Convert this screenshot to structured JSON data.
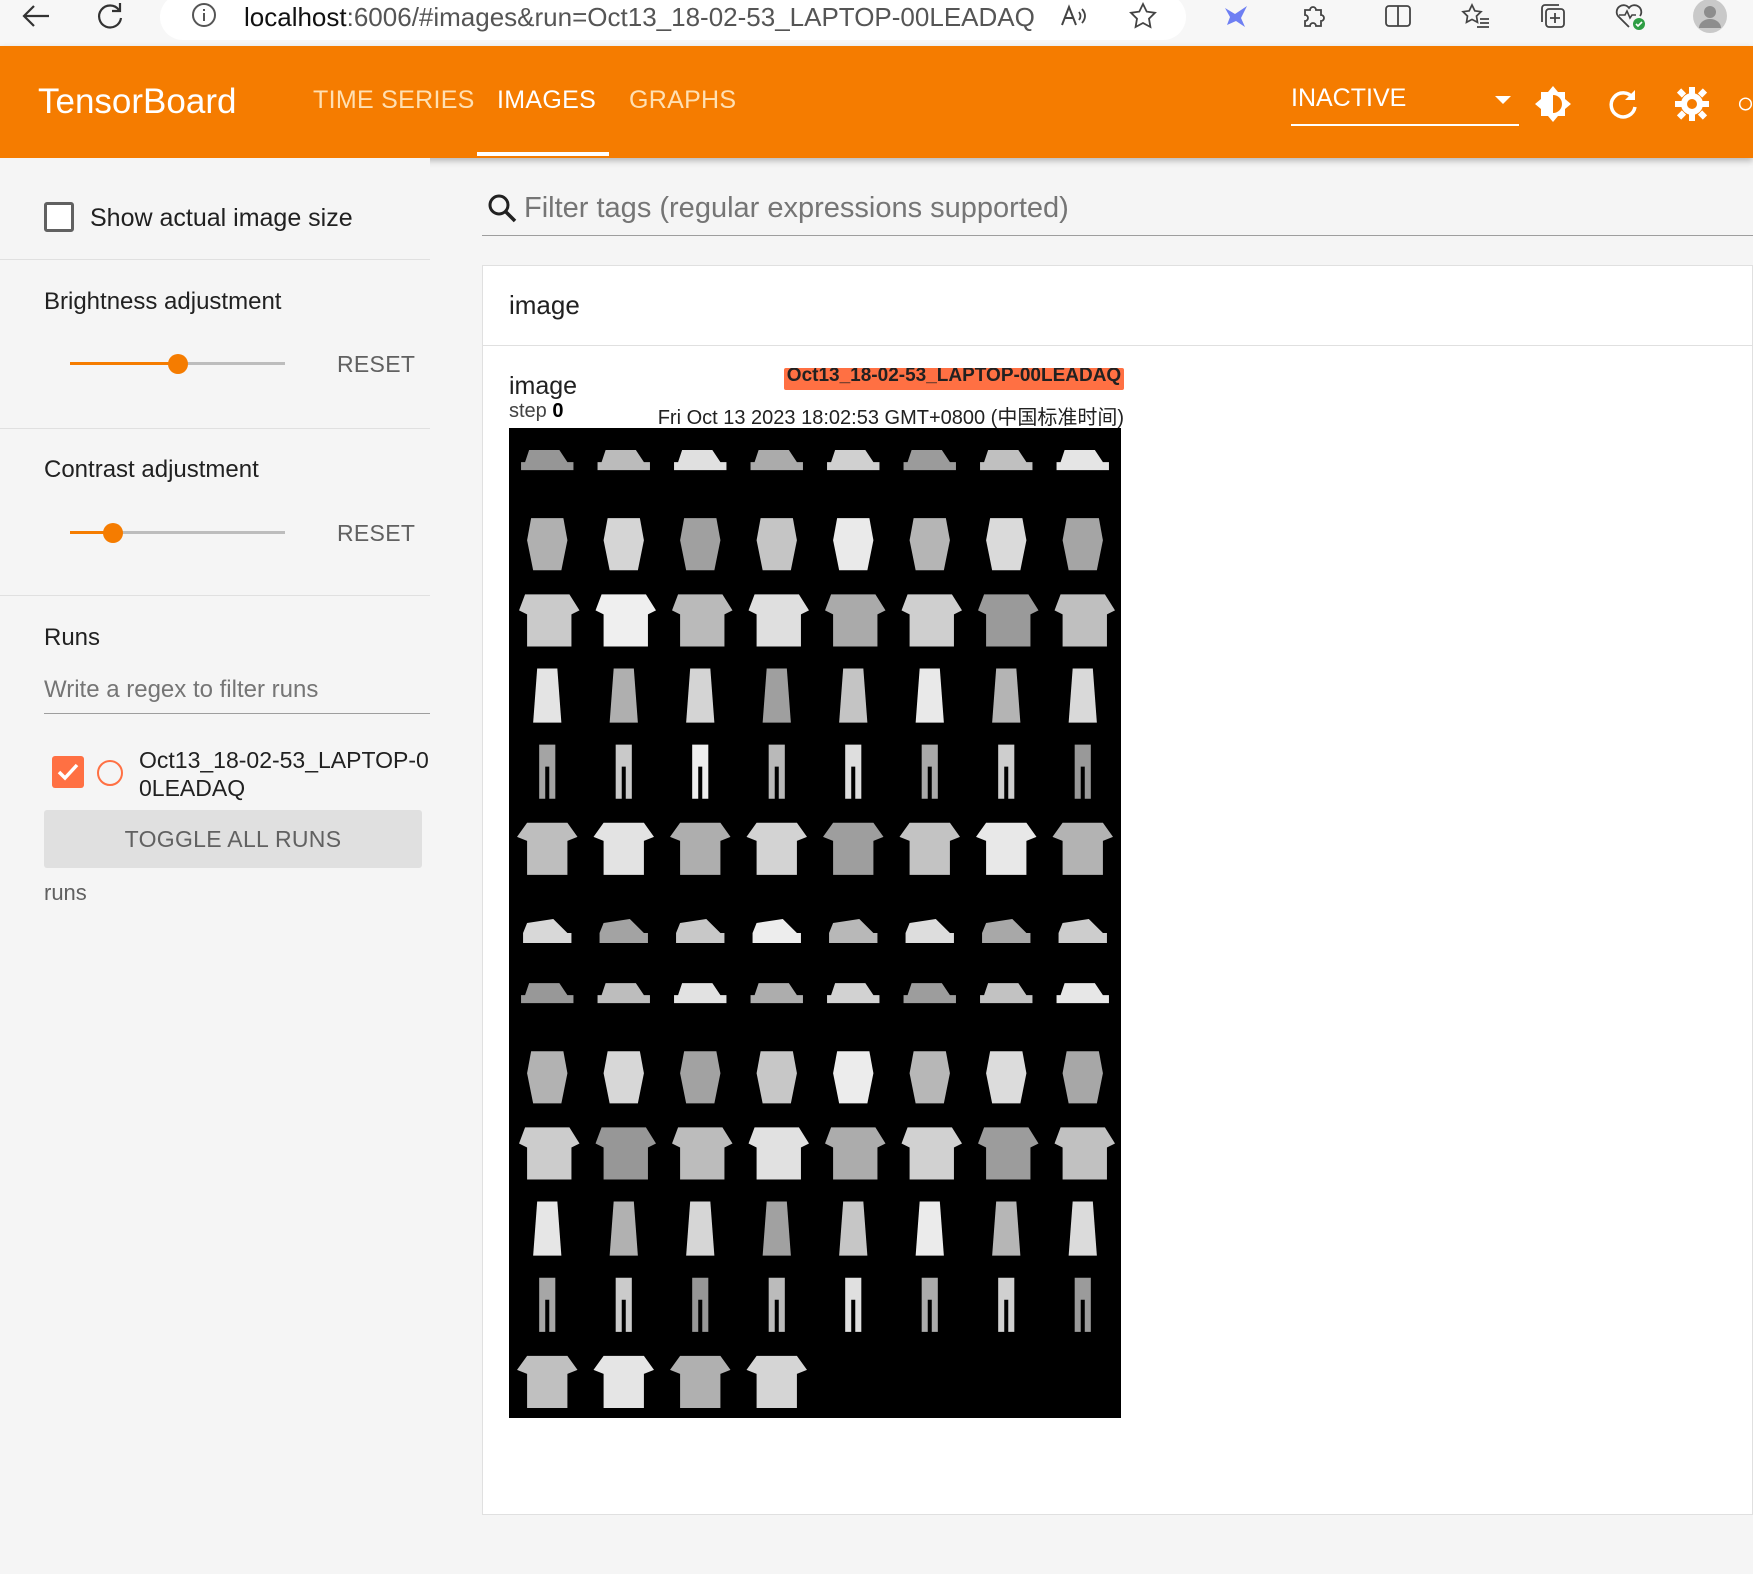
{
  "browser": {
    "url_prefix": "localhost",
    "url_rest": ":6006/#images&run=Oct13_18-02-53_LAPTOP-00LEADAQ",
    "icons": [
      "back-icon",
      "refresh-icon",
      "info-icon",
      "read-aloud-icon",
      "favorite-star-icon",
      "extension-bird-icon",
      "extensions-puzzle-icon",
      "split-screen-icon",
      "favorites-list-icon",
      "collections-icon",
      "browser-health-icon",
      "profile-avatar-icon"
    ]
  },
  "header": {
    "brand": "TensorBoard",
    "tabs": [
      {
        "label": "TIME SERIES"
      },
      {
        "label": "IMAGES"
      },
      {
        "label": "GRAPHS"
      }
    ],
    "status_select": "INACTIVE",
    "icons": [
      "theme-toggle-icon",
      "reload-icon",
      "settings-gear-icon"
    ],
    "accent_color": "#f57c00"
  },
  "sidebar": {
    "show_actual_size_label": "Show actual image size",
    "show_actual_size_checked": false,
    "brightness": {
      "label": "Brightness adjustment",
      "reset": "RESET",
      "level": 0.5
    },
    "contrast": {
      "label": "Contrast adjustment",
      "reset": "RESET",
      "level": 0.2
    },
    "runs": {
      "title": "Runs",
      "filter_placeholder": "Write a regex to filter runs",
      "items": [
        {
          "name": "Oct13_18-02-53_LAPTOP-00LEADAQ",
          "checked": true,
          "color": "#ff7043"
        }
      ],
      "toggle_all": "TOGGLE ALL RUNS",
      "caption": "runs"
    }
  },
  "main": {
    "filter_placeholder": "Filter tags (regular expressions supported)",
    "card": {
      "title": "image",
      "image_name": "image",
      "step_label": "step",
      "step_value": "0",
      "run_badge": "Oct13_18-02-53_LAPTOP-00LEADAQ",
      "timestamp": "Fri Oct 13 2023 18:02:53 GMT+0800 (中国标准时间)",
      "grid": {
        "columns": 8,
        "rows": 13,
        "tile_count": 100
      }
    }
  }
}
